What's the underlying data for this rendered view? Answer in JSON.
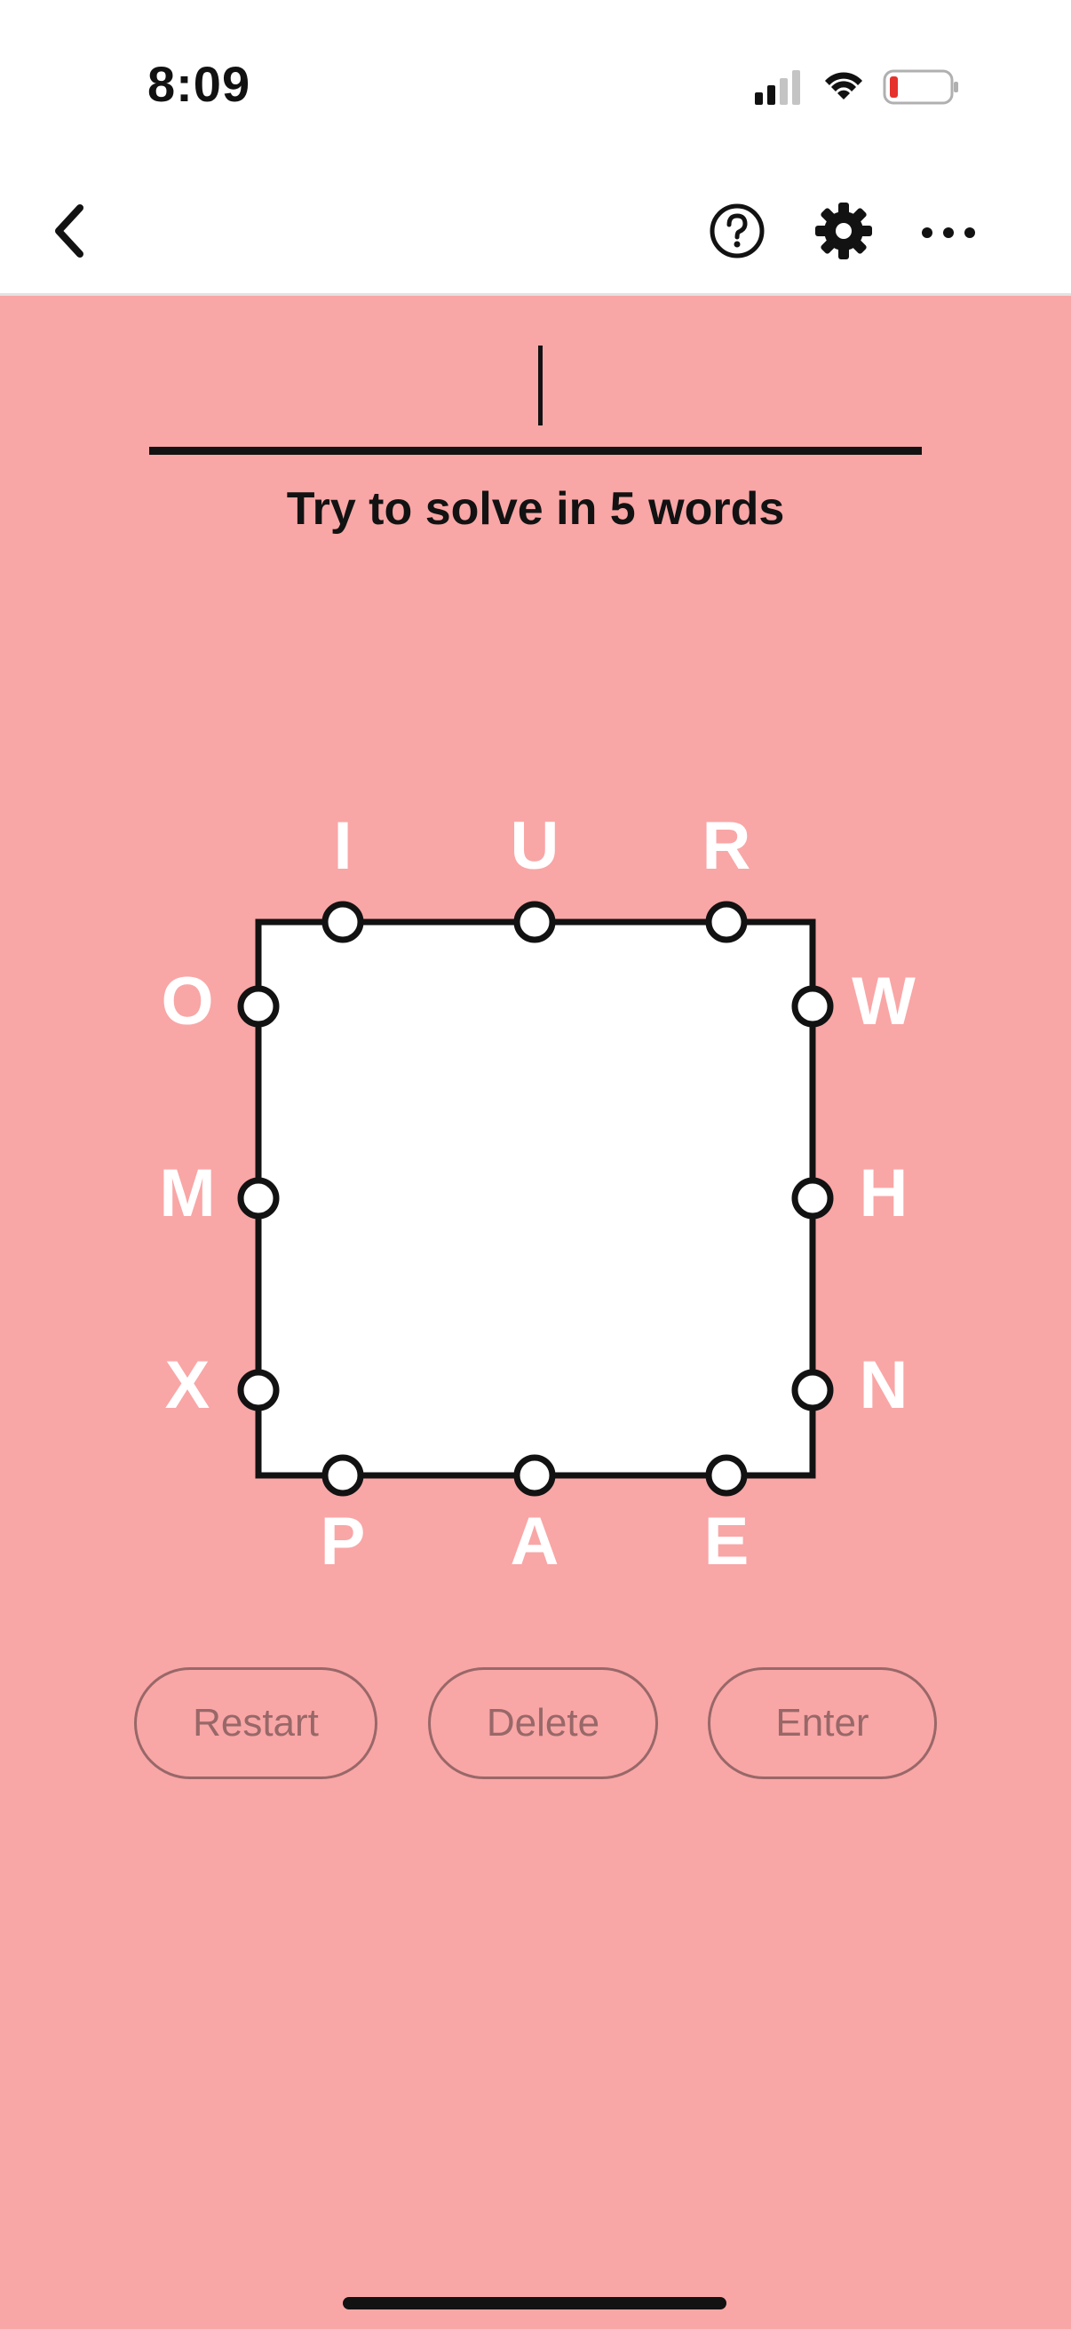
{
  "status_bar": {
    "time": "8:09"
  },
  "colors": {
    "background": "#f9a6a6",
    "box_fill": "#ffffff",
    "stroke": "#121212",
    "letter": "#ffffff",
    "button_text": "#8e6262",
    "battery_low": "#e5322d"
  },
  "nav": {
    "icons": [
      "back-arrow-icon",
      "help-icon",
      "gear-icon",
      "more-icon"
    ]
  },
  "game": {
    "hint": "Try to solve in 5 words",
    "letters": {
      "top": [
        "I",
        "U",
        "R"
      ],
      "left": [
        "O",
        "M",
        "X"
      ],
      "right": [
        "W",
        "H",
        "N"
      ],
      "bottom": [
        "P",
        "A",
        "E"
      ]
    }
  },
  "actions": {
    "restart": "Restart",
    "delete": "Delete",
    "enter": "Enter"
  }
}
